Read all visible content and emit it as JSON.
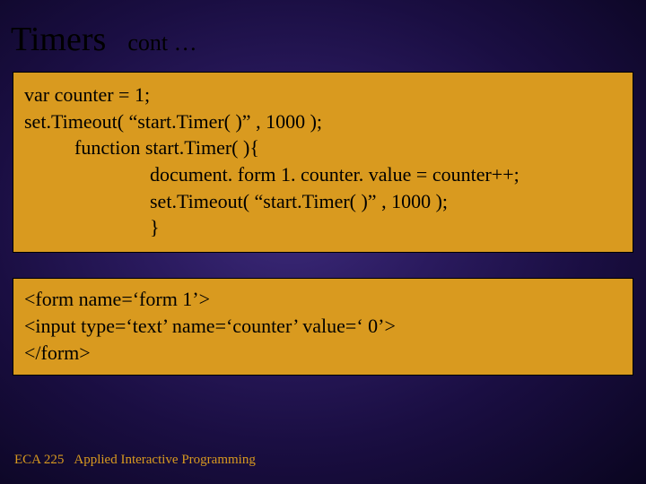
{
  "header": {
    "title": "Timers",
    "subtitle": "cont …"
  },
  "code1": {
    "l1": "var counter = 1;",
    "l2": "set.Timeout( “start.Timer( )” , 1000 );",
    "l3": "function start.Timer( ){",
    "l4": "document. form 1. counter. value = counter++;",
    "l5": "set.Timeout( “start.Timer( )” , 1000 );",
    "l6": "}"
  },
  "code2": {
    "l1": "<form name=‘form 1’>",
    "l2": "<input type=‘text’ name=‘counter’ value=‘ 0’>",
    "l3": "</form>"
  },
  "footer": {
    "course": "ECA 225",
    "title": "Applied Interactive Programming"
  }
}
